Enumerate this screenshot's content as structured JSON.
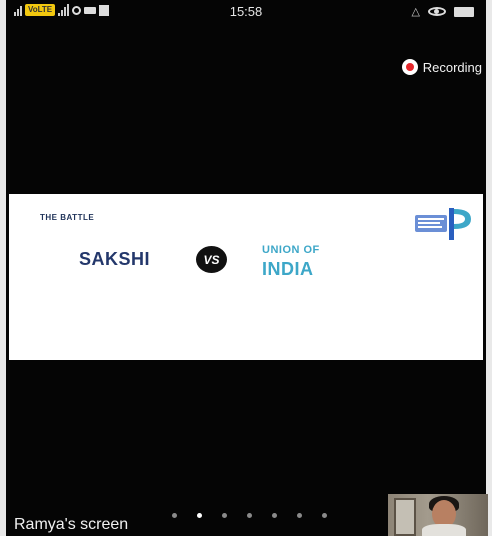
{
  "status_bar": {
    "time": "15:58",
    "volte_label": "VoLTE",
    "left_icons": [
      "signal-icon",
      "volte-icon",
      "signal-icon",
      "sync-icon",
      "video-icon",
      "download-icon"
    ],
    "right_icons": [
      "alarm-icon",
      "eye-icon",
      "battery-icon"
    ]
  },
  "recording": {
    "label": "Recording",
    "dot_color": "#e5262b"
  },
  "slide": {
    "kicker": "THE BATTLE",
    "left_party": "SAKSHI",
    "vs_label": "VS",
    "right_party_line1": "UNION OF",
    "right_party_line2": "INDIA",
    "logo_icon": "project-logo-icon",
    "colors": {
      "navy": "#23376b",
      "teal": "#3da7c8"
    }
  },
  "share": {
    "presenter_label": "Ramya's screen",
    "pages": 7,
    "active_page": 2
  },
  "video_thumbnail": {
    "icon": "participant-video-thumbnail"
  }
}
